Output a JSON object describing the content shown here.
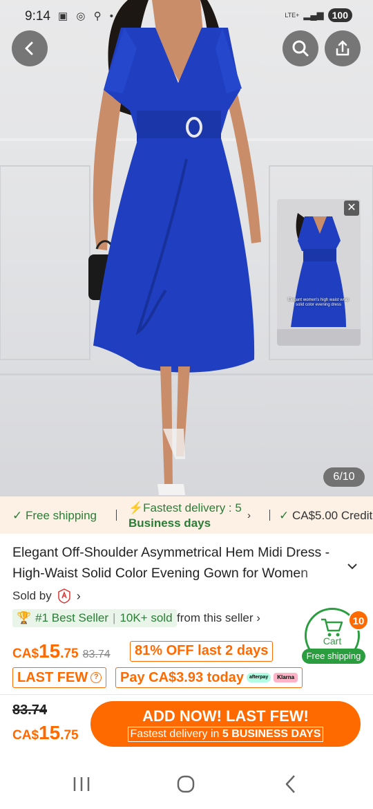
{
  "status_bar": {
    "time": "9:14",
    "network": "LTE+",
    "battery": "100"
  },
  "gallery": {
    "counter": "6/10",
    "pip_caption": "Elegant women's high waist wrap solid color evening dress"
  },
  "benefits": {
    "free_shipping": "Free shipping",
    "fastest_delivery_prefix": "Fastest delivery : 5",
    "fastest_delivery_suffix": "Business days",
    "credit": "CA$5.00 Credit"
  },
  "product": {
    "title": "Elegant Off-Shoulder Asymmetrical Hem Midi Dress - High-Waist Solid Color Evening Gown for Women",
    "sold_by_label": "Sold by",
    "best_seller": "#1 Best Seller",
    "sold_count": "10K+ sold",
    "from_seller": "from this seller",
    "price": {
      "currency": "CA$",
      "whole": "15",
      "decimal": ".75"
    },
    "original_price": "83.74",
    "discount_badge": "81% OFF last 2 days",
    "last_few_badge": "LAST FEW",
    "pay_today": "Pay CA$3.93 today",
    "afterpay_label": "afterpay",
    "klarna_label": "Klarna"
  },
  "cart": {
    "label": "Cart",
    "free_shipping": "Free shipping",
    "count": "10"
  },
  "purchase_bar": {
    "original_price": "83.74",
    "price": {
      "currency": "CA$",
      "whole": "15",
      "decimal": ".75"
    },
    "button_label": "ADD NOW! LAST FEW!",
    "button_sub_prefix": "Fastest delivery in",
    "button_sub_strong": "5 BUSINESS DAYS"
  },
  "colors": {
    "accent": "#ff6a00",
    "green": "#2a7d36",
    "dress_blue": "#1f3fc0"
  }
}
